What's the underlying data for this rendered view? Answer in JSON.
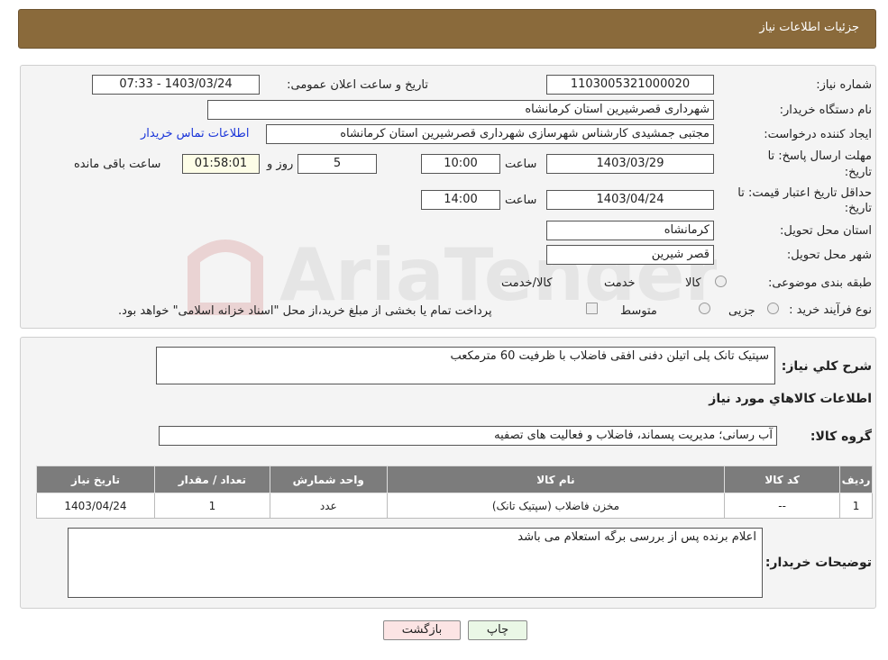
{
  "header": {
    "title": "جزئیات اطلاعات نیاز"
  },
  "form": {
    "need_number_label": "شماره نیاز:",
    "need_number": "1103005321000020",
    "announce_label": "تاریخ و ساعت اعلان عمومی:",
    "announce_value": "1403/03/24 - 07:33",
    "buyer_org_label": "نام دستگاه خریدار:",
    "buyer_org": "شهرداری قصرشیرین استان کرمانشاه",
    "creator_label": "ایجاد کننده درخواست:",
    "creator": "مجتبی جمشیدی کارشناس شهرسازی شهرداری قصرشیرین استان کرمانشاه",
    "contact_link": "اطلاعات تماس خریدار",
    "deadline_label_1": "مهلت ارسال پاسخ: تا",
    "deadline_label_2": "تاریخ:",
    "deadline_date": "1403/03/29",
    "time_label": "ساعت",
    "deadline_time": "10:00",
    "days_value": "5",
    "days_label": "روز و",
    "remaining_value": "01:58:01",
    "remaining_label": "ساعت باقی مانده",
    "validity_label_1": "حداقل تاریخ اعتبار قیمت: تا",
    "validity_label_2": "تاریخ:",
    "validity_date": "1403/04/24",
    "validity_time": "14:00",
    "province_label": "استان محل تحویل:",
    "province": "کرمانشاه",
    "city_label": "شهر محل تحویل:",
    "city": "قصر شیرین",
    "category_label": "طبقه بندی موضوعی:",
    "category_options": [
      "کالا",
      "خدمت",
      "کالا/خدمت"
    ],
    "process_label": "نوع فرآیند خرید :",
    "process_options": [
      "جزیی",
      "متوسط"
    ],
    "process_note": "پرداخت تمام یا بخشی از مبلغ خرید،از محل \"اسناد خزانه اسلامی\" خواهد بود."
  },
  "details": {
    "summary_label": "شرح کلي نياز:",
    "summary": "سپتیک تانک پلی اتیلن دفنی افقی فاضلاب با ظرفیت  60 مترمکعب",
    "goods_info_title": "اطلاعات کالاهاي مورد نياز",
    "goods_group_label": "گروه کالا:",
    "goods_group": "آب رسانی؛ مدیریت پسماند، فاضلاب و فعالیت های تصفیه",
    "table_headers": [
      "رديف",
      "کد کالا",
      "نام کالا",
      "واحد شمارش",
      "تعداد / مقدار",
      "تاریخ نیاز"
    ],
    "table_rows": [
      {
        "row": "1",
        "code": "--",
        "name": "مخزن فاضلاب (سپتیک تانک)",
        "unit": "عدد",
        "qty": "1",
        "date": "1403/04/24"
      }
    ],
    "buyer_notes_label": "توضیحات خریدار:",
    "buyer_notes": "اعلام برنده پس از بررسی برگه استعلام می باشد"
  },
  "buttons": {
    "print": "چاپ",
    "back": "بازگشت"
  },
  "watermark": {
    "text": "AriaTender.neT"
  }
}
